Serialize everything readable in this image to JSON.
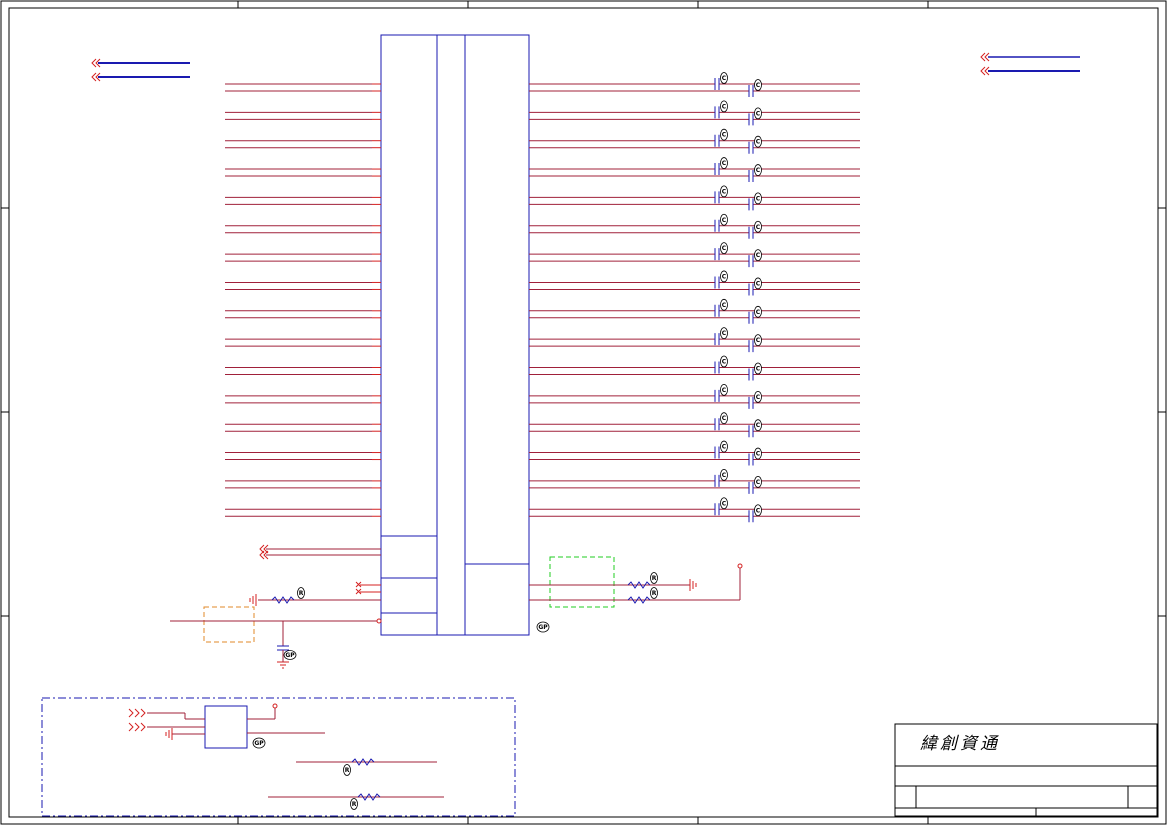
{
  "title_block": {
    "company": "緯創資通"
  },
  "badges": {
    "gp": "GP",
    "c": "C",
    "r": "R"
  },
  "colors": {
    "net_wire": "#a0203a",
    "component_pin": "#d42020",
    "bus_line": "#1a1ab0",
    "ic_body": "#1a1ab0",
    "green_group": "#22cc22",
    "orange_group": "#e08a2a",
    "blue_group": "#1a1ab0",
    "border": "#000000"
  }
}
